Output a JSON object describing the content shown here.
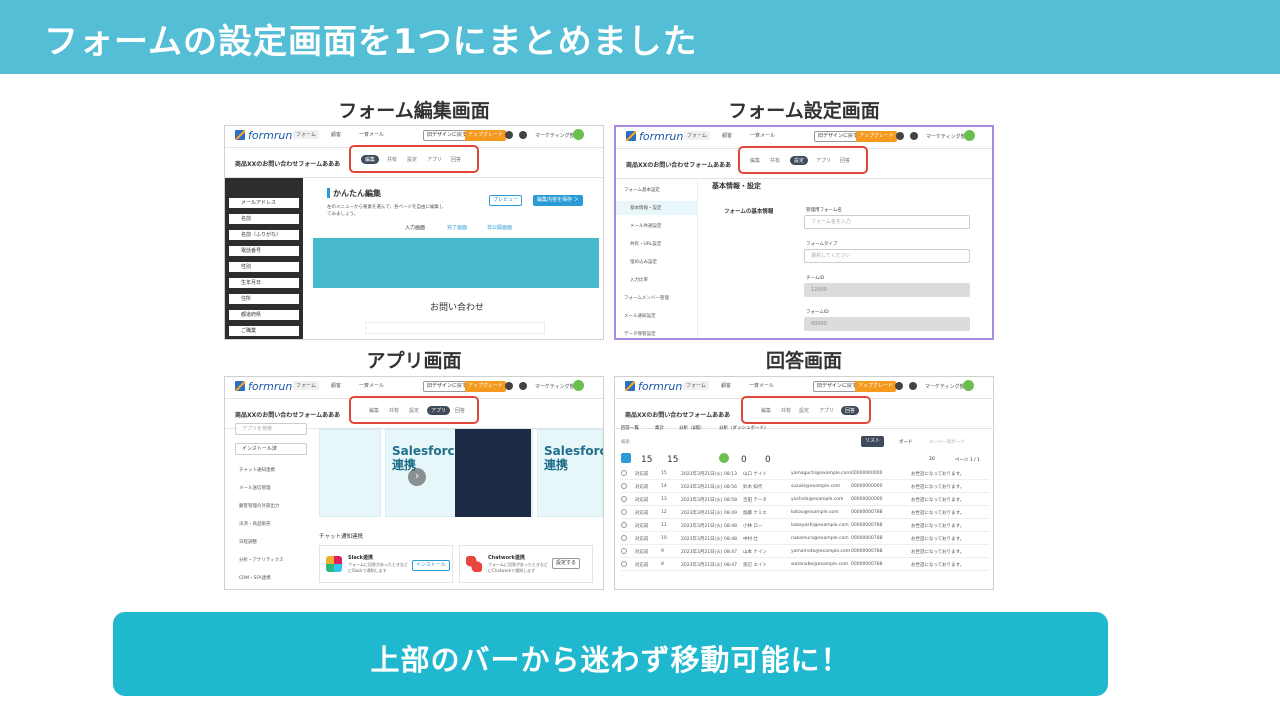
{
  "slide": {
    "title": "フォームの設定画面を1つにまとめました",
    "cta": "上部のバーから迷わず移動可能に！"
  },
  "panels": {
    "edit": "フォーム編集画面",
    "settings": "フォーム設定画面",
    "apps": "アプリ画面",
    "responses": "回答画面"
  },
  "app": {
    "logo": "formrun",
    "nav": [
      "フォーム",
      "顧客",
      "一斉メール"
    ],
    "design_button": "旧デザインに戻す",
    "upgrade": "アップグレード",
    "user": "マーケティング部",
    "form_name": "商品XXのお問い合わせフォームあああ",
    "tabs": [
      "編集",
      "共有",
      "設定",
      "アプリ",
      "回答"
    ]
  },
  "edit_screen": {
    "sidebar_items": [
      "メールアドレス",
      "名前",
      "名前（ふりがな）",
      "電話番号",
      "性別",
      "生年月日",
      "住所",
      "都道府県",
      "ご職業"
    ],
    "heading": "かんたん編集",
    "description": "左のメニューから要素を選んで、各ページを自由に編集してみましょう。",
    "preview": "プレビュー",
    "save": "編集内容を保存 ＞",
    "page_tabs": [
      "入力画面",
      "完了画面",
      "非公開画面"
    ],
    "form_title": "お問い合わせ"
  },
  "settings_screen": {
    "side_items": [
      "フォーム基本設定",
      "基本情報・設定",
      "メール共通設定",
      "共有・URL設定",
      "埋め込み設定",
      "入力比率",
      "フォームメンバー管理",
      "メール通知設定",
      "データ保管設定"
    ],
    "section_title": "基本情報・設定",
    "group_label": "フォームの基本情報",
    "fields": [
      {
        "label": "管理用フォーム名",
        "value": "フォーム名を入力"
      },
      {
        "label": "フォームタイプ",
        "value": "選択してください"
      },
      {
        "label": "チームID",
        "value": "12000"
      },
      {
        "label": "フォームID",
        "value": "00000"
      }
    ]
  },
  "apps_screen": {
    "search_placeholder": "アプリを検索",
    "installed": "インストール済",
    "categories": [
      "チャット通知連携",
      "メール送信管理",
      "顧客管理の外部出力",
      "決済・商品販売",
      "日程調整",
      "分析・アナリティクス",
      "CRM・SFA連携"
    ],
    "card_title": "Salesforce 連携",
    "card_title_short": "Salesforc 連携",
    "section": "チャット通知連携",
    "slack": {
      "name": "Slack連携",
      "desc": "フォームに回答があったときなどにSlackで通知します",
      "button": "インストール"
    },
    "chatwork": {
      "name": "Chatwork連携",
      "desc": "フォームに回答があったときなどにChatworkで通知します",
      "button": "設定する"
    }
  },
  "responses_screen": {
    "views": [
      "回答一覧",
      "集計",
      "分析（β版）",
      "分析（ダッシュボード）"
    ],
    "search": "検索",
    "list_label": "リスト",
    "board_label": "ボード",
    "member_label": "メンバー別ボード",
    "stats": [
      "15",
      "15",
      "0",
      "0"
    ],
    "pagination": "ページ 1 / 1",
    "per_page": "20",
    "rows": [
      {
        "status": "対応前",
        "no": "15",
        "date": "2023年3月21日(火) 08:13",
        "name": "山口 ナイイ",
        "email": "yamaguchi@example.com",
        "phone": "00000000000",
        "note": "お世話になっております。"
      },
      {
        "status": "対応前",
        "no": "14",
        "date": "2023年3月21日(火) 08:56",
        "name": "鈴木 知代",
        "email": "suzuki@example.com",
        "phone": "00000000000",
        "note": "お世話になっております。"
      },
      {
        "status": "対応前",
        "no": "13",
        "date": "2023年3月21日(火) 08:58",
        "name": "吉田 テータ",
        "email": "yoshida@example.com",
        "phone": "00000000000",
        "note": "お世話になっております。"
      },
      {
        "status": "対応前",
        "no": "12",
        "date": "2023年3月21日(火) 08:49",
        "name": "加藤 ナミエ",
        "email": "katou@example.com",
        "phone": "00000000788",
        "note": "お世話になっております。"
      },
      {
        "status": "対応前",
        "no": "11",
        "date": "2023年3月21日(火) 08:48",
        "name": "小林 ロー",
        "email": "kobayashi@example.com",
        "phone": "00000000788",
        "note": "お世話になっております。"
      },
      {
        "status": "対応前",
        "no": "10",
        "date": "2023年3月21日(火) 08:48",
        "name": "中村 壮",
        "email": "nakamura@example.com",
        "phone": "00000000788",
        "note": "お世話になっております。"
      },
      {
        "status": "対応前",
        "no": "9",
        "date": "2023年3月21日(火) 08:47",
        "name": "山本 ナイン",
        "email": "yamamoto@example.com",
        "phone": "00000000788",
        "note": "お世話になっております。"
      },
      {
        "status": "対応前",
        "no": "8",
        "date": "2023年3月21日(火) 08:47",
        "name": "渡辺 エイト",
        "email": "watanabe@example.com",
        "phone": "00000000788",
        "note": "お世話になっております。"
      }
    ]
  },
  "colors": {
    "header": "#53bed5",
    "cta": "#1fb8cf",
    "highlight": "#e0493a",
    "selected_border": "#a98ce0"
  }
}
